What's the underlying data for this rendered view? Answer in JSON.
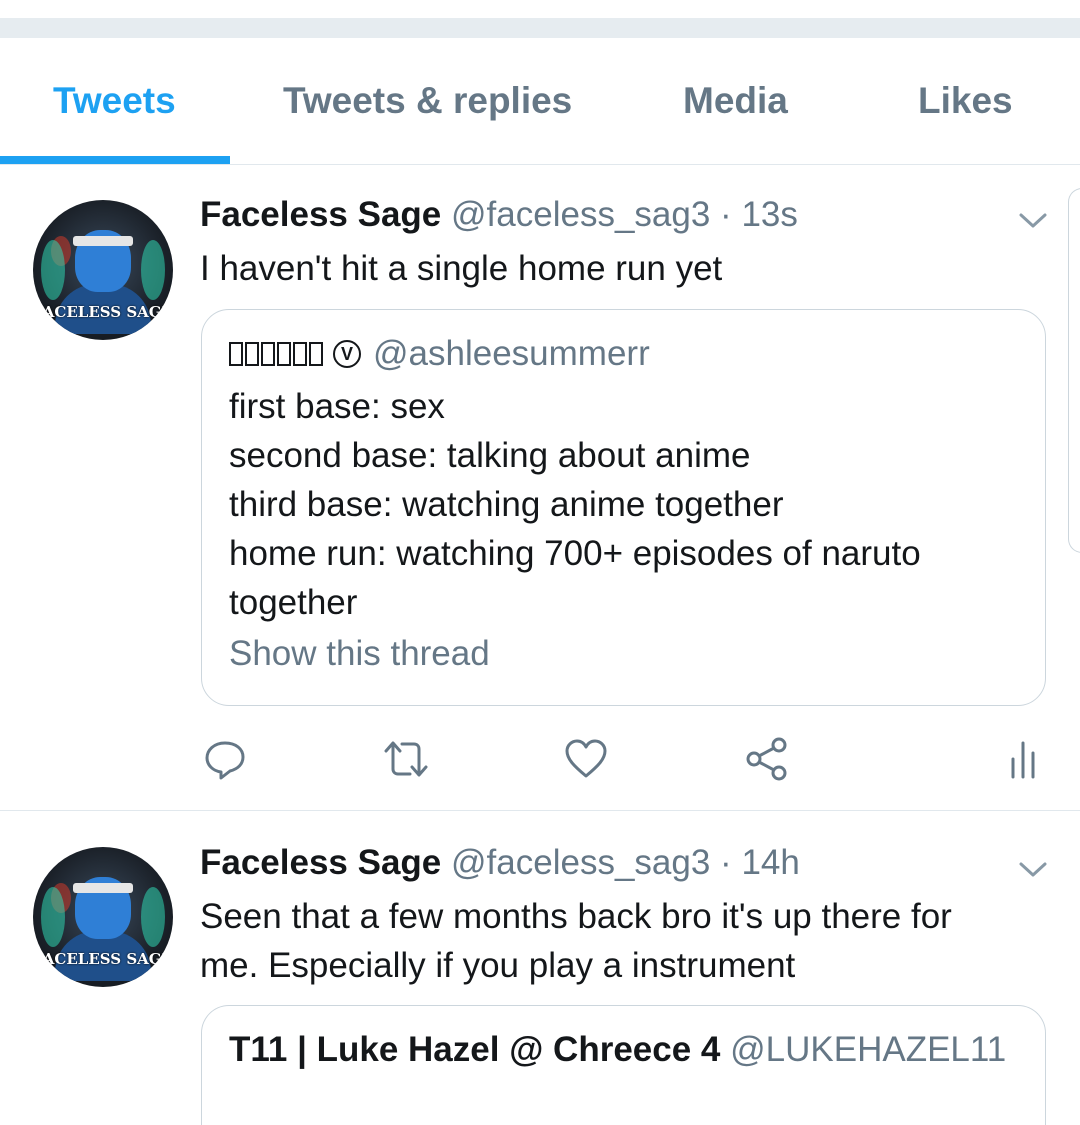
{
  "tabs": [
    {
      "label": "Tweets",
      "active": true
    },
    {
      "label": "Tweets & replies",
      "active": false
    },
    {
      "label": "Media",
      "active": false
    },
    {
      "label": "Likes",
      "active": false
    }
  ],
  "tweets": [
    {
      "name": "Faceless Sage",
      "handle": "@faceless_sag3",
      "time": "13s",
      "separator": "·",
      "avatar_text": "FACELESS SAGE",
      "text": "I haven't hit a single home run yet",
      "quote": {
        "name_glyph_count": 6,
        "badge": "V",
        "handle": "@ashleesummerr",
        "lines": [
          "first base: sex",
          "second base: talking about anime",
          "third base: watching anime together",
          "home run: watching 700+ episodes of naruto",
          "together"
        ],
        "show_thread": "Show this thread"
      },
      "actions": [
        "reply-icon",
        "retweet-icon",
        "like-icon",
        "share-icon",
        "analytics-icon"
      ]
    },
    {
      "name": "Faceless Sage",
      "handle": "@faceless_sag3",
      "time": "14h",
      "separator": "·",
      "avatar_text": "FACELESS SAGE",
      "text_lines": [
        "Seen that a few months back bro it's up there for",
        "me. Especially if you play a instrument"
      ],
      "quote": {
        "name": "T11 | Luke Hazel @ Chreece 4",
        "handle": "@LUKEHAZEL11"
      }
    }
  ],
  "colors": {
    "accent": "#1da1f2",
    "secondary_text": "#657786",
    "primary_text": "#14171a",
    "border": "#e1e8ed"
  }
}
